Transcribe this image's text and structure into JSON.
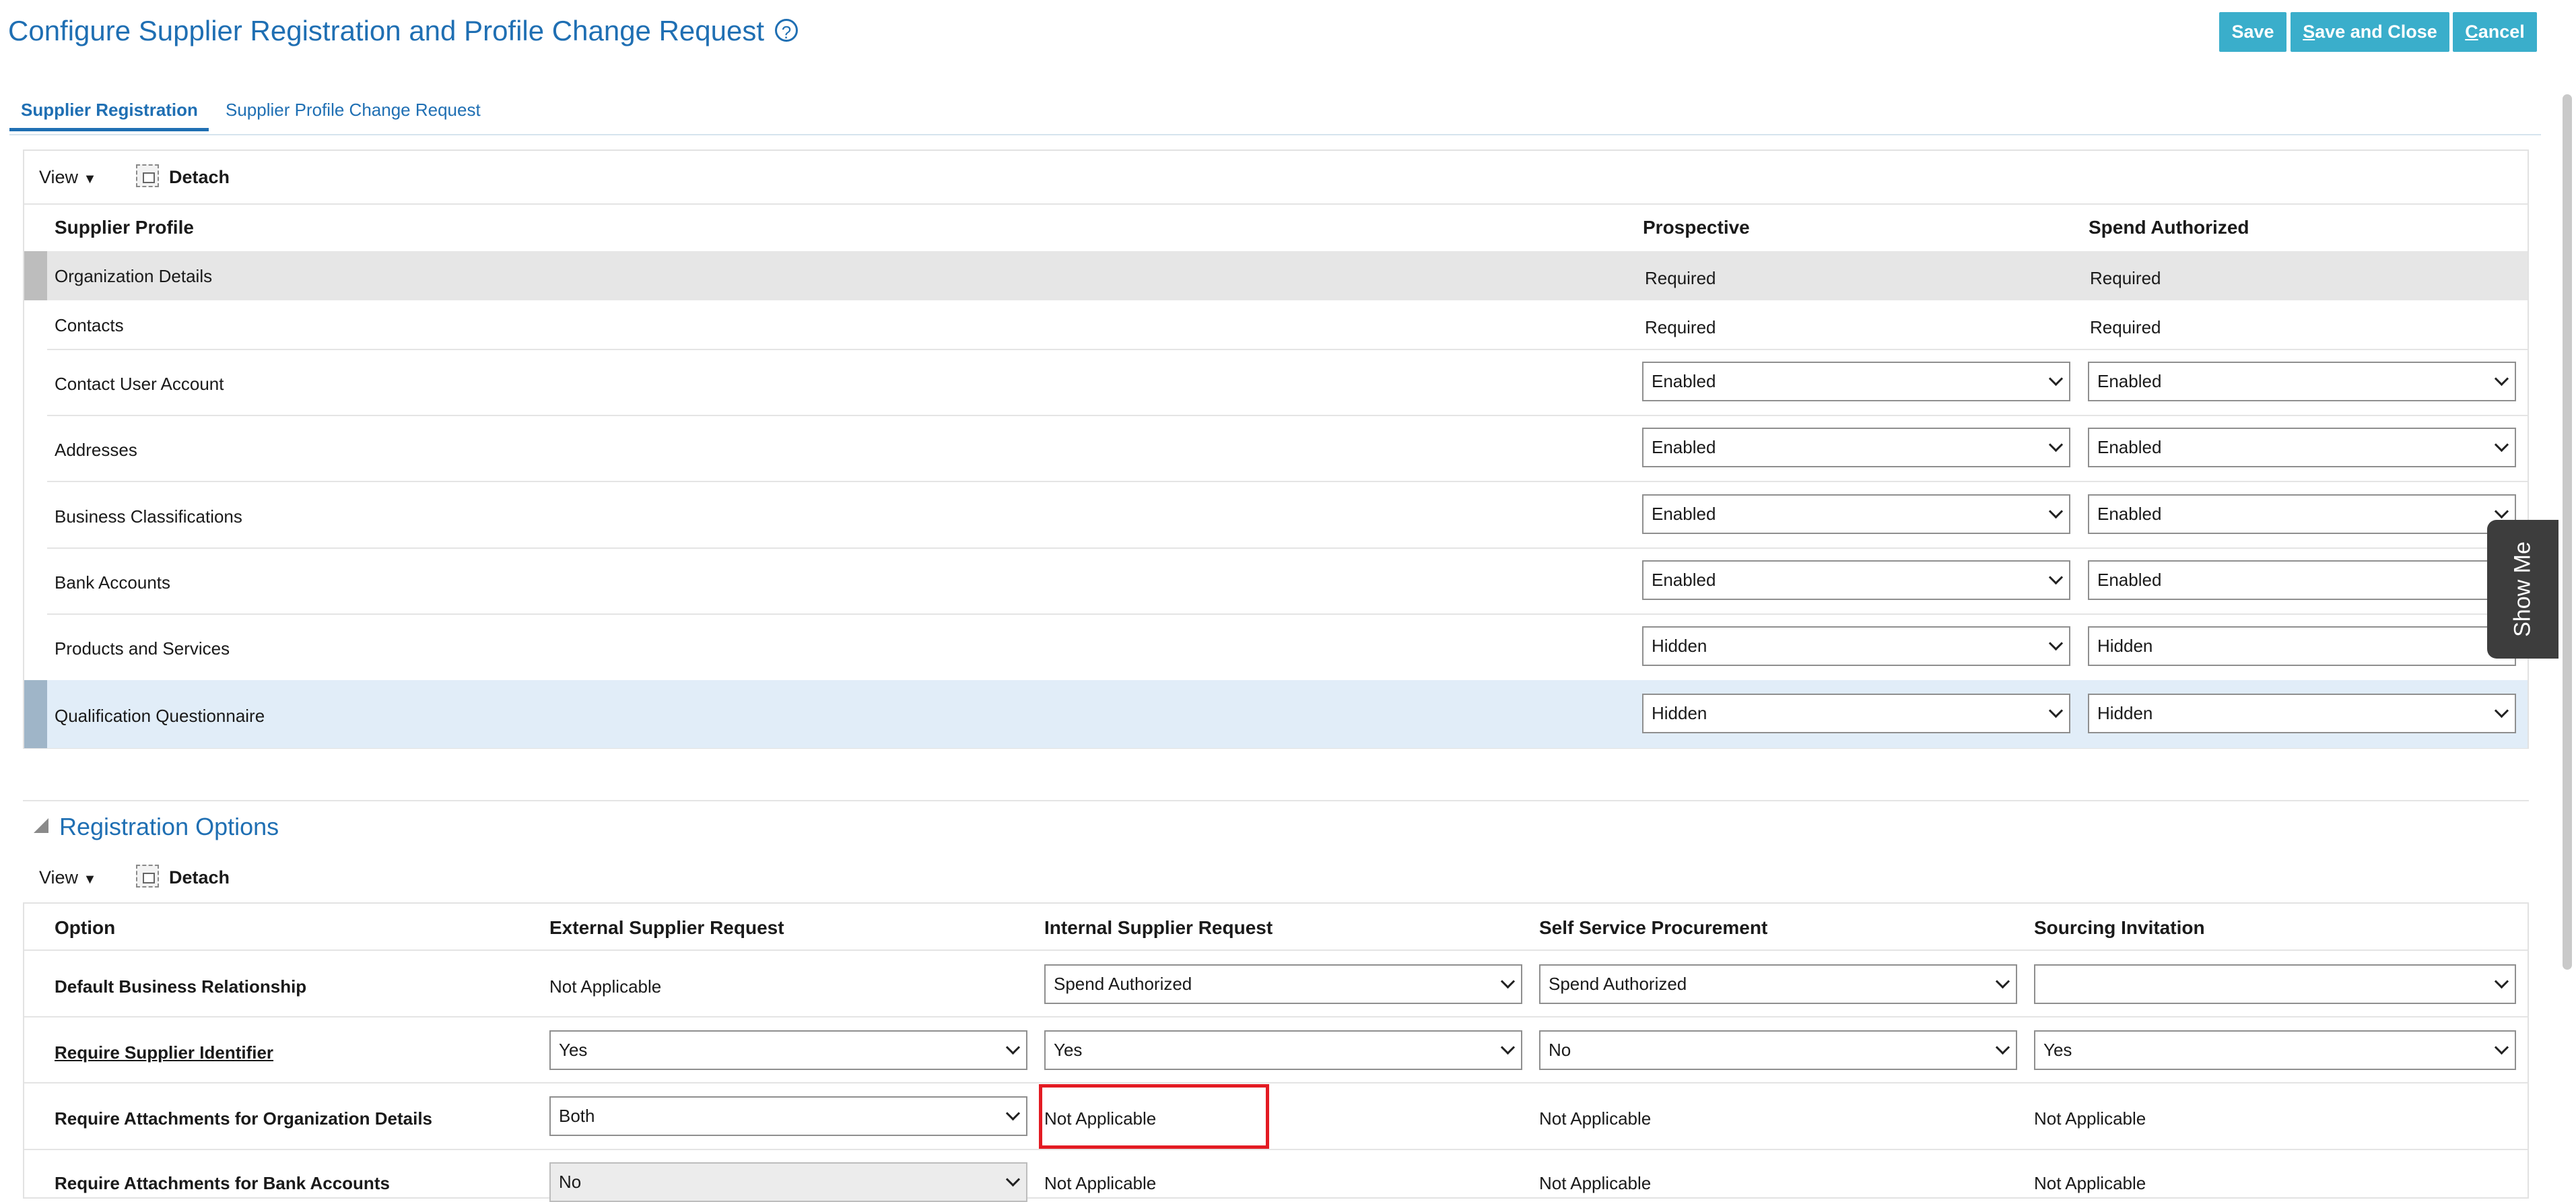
{
  "header": {
    "title": "Configure Supplier Registration and Profile Change Request",
    "help_icon": "?",
    "save_label": "Save",
    "save_close_first": "S",
    "save_close_rest": "ave and Close",
    "cancel_first": "C",
    "cancel_rest": "ancel"
  },
  "tabs": [
    {
      "label": "Supplier Registration",
      "active": true
    },
    {
      "label": "Supplier Profile Change Request",
      "active": false
    }
  ],
  "profile_table": {
    "toolbar": {
      "view_label": "View",
      "view_caret": "▼",
      "detach_label": "Detach"
    },
    "columns": [
      "Supplier Profile",
      "Prospective",
      "Spend Authorized"
    ],
    "rows": [
      {
        "name": "Organization Details",
        "prospective": "Required",
        "spend": "Required"
      },
      {
        "name": "Contacts",
        "prospective": "Required",
        "spend": "Required"
      },
      {
        "name": "Contact User Account",
        "prospective": "Enabled",
        "spend": "Enabled"
      },
      {
        "name": "Addresses",
        "prospective": "Enabled",
        "spend": "Enabled"
      },
      {
        "name": "Business Classifications",
        "prospective": "Enabled",
        "spend": "Enabled"
      },
      {
        "name": "Bank Accounts",
        "prospective": "Enabled",
        "spend": "Enabled"
      },
      {
        "name": "Products and Services",
        "prospective": "Hidden",
        "spend": "Hidden"
      },
      {
        "name": "Qualification Questionnaire",
        "prospective": "Hidden",
        "spend": "Hidden"
      }
    ]
  },
  "registration_options": {
    "section_title": "Registration Options",
    "toolbar": {
      "view_label": "View",
      "view_caret": "▼",
      "detach_label": "Detach"
    },
    "columns": [
      "Option",
      "External Supplier Request",
      "Internal Supplier Request",
      "Self Service Procurement",
      "Sourcing Invitation"
    ],
    "rows": [
      {
        "option": "Default Business Relationship",
        "external": "Not Applicable",
        "internal": "Spend Authorized",
        "self_service": "Spend Authorized",
        "sourcing": ""
      },
      {
        "option": "Require Supplier Identifier",
        "external": "Yes",
        "internal": "Yes",
        "self_service": "No",
        "sourcing": "Yes"
      },
      {
        "option": "Require Attachments for Organization Details",
        "external": "Both",
        "internal": "Not Applicable",
        "self_service": "Not Applicable",
        "sourcing": "Not Applicable"
      },
      {
        "option": "Require Attachments for Bank Accounts",
        "external": "No",
        "internal": "Not Applicable",
        "self_service": "Not Applicable",
        "sourcing": "Not Applicable"
      }
    ]
  },
  "show_me": {
    "label": "Show Me"
  },
  "colors": {
    "accent": "#1f6fb3",
    "button": "#3aaecb",
    "highlight_box": "#e31b23",
    "selected_row": "#e1edf8"
  }
}
